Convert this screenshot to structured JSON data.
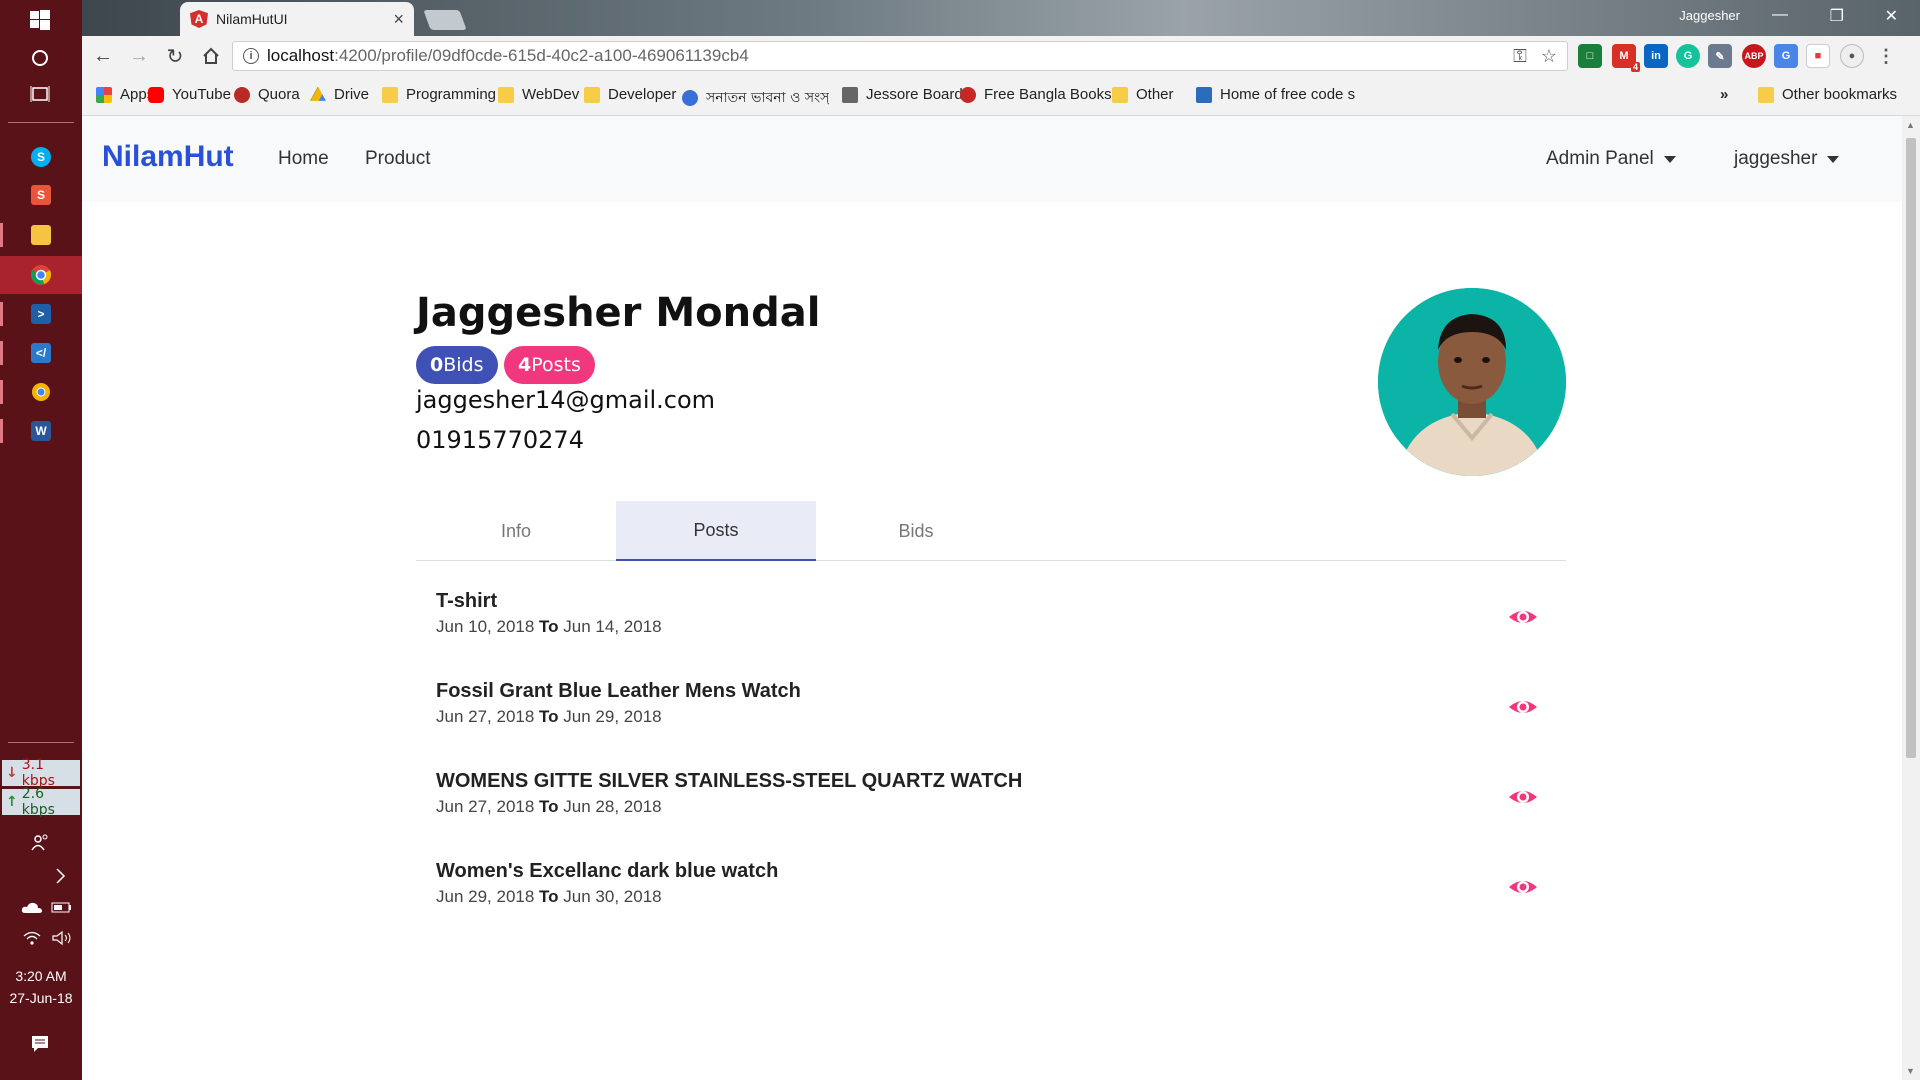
{
  "taskbar": {
    "net_down": "3.1 kbps",
    "net_up": "2.6 kbps",
    "time": "3:20 AM",
    "date": "27-Jun-18"
  },
  "browser": {
    "tab_title": "NilamHutUI",
    "window_user": "Jaggesher",
    "url_host": "localhost",
    "url_path": ":4200/profile/09df0cde-615d-40c2-a100-469061139cb4",
    "bookmarks": [
      "Apps",
      "YouTube",
      "Quora",
      "Drive",
      "Programming",
      "WebDev",
      "Developer",
      "সনাতন ভাবনা ও সংস্",
      "Jessore Board",
      "Free Bangla Books",
      "Other",
      "Home of free code s"
    ],
    "bookmarks_overflow": "»",
    "other_bookmarks": "Other bookmarks",
    "gmail_badge": "4"
  },
  "navbar": {
    "brand": "NilamHut",
    "links": [
      "Home",
      "Product"
    ],
    "admin_panel": "Admin Panel",
    "user": "jaggesher"
  },
  "profile": {
    "name": "Jaggesher Mondal",
    "bids_count": "0",
    "bids_label": "Bids",
    "posts_count": "4",
    "posts_label": "Posts",
    "email": "jaggesher14@gmail.com",
    "phone": "01915770274"
  },
  "tabs": [
    "Info",
    "Posts",
    "Bids"
  ],
  "active_tab": "Posts",
  "to_label": "To",
  "posts": [
    {
      "title": "T-shirt",
      "start": "Jun 10, 2018",
      "end": "Jun 14, 2018"
    },
    {
      "title": "Fossil Grant Blue Leather Mens Watch",
      "start": "Jun 27, 2018",
      "end": "Jun 29, 2018"
    },
    {
      "title": "WOMENS GITTE SILVER STAINLESS-STEEL QUARTZ WATCH",
      "start": "Jun 27, 2018",
      "end": "Jun 28, 2018"
    },
    {
      "title": "Women's Excellanc dark blue watch",
      "start": "Jun 29, 2018",
      "end": "Jun 30, 2018"
    }
  ],
  "colors": {
    "brand": "#2b50d8",
    "bids_pill": "#3f51b5",
    "posts_pill": "#f1377d",
    "eye_icon": "#f1377d",
    "avatar_bg": "#0bb4a6",
    "taskbar": "#5a1219"
  }
}
